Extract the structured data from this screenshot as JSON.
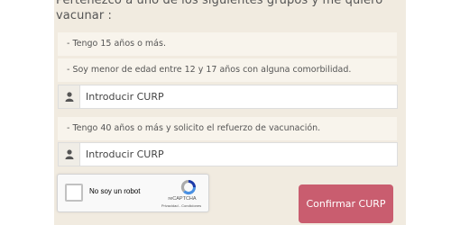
{
  "form": {
    "heading": "Pertenezco a uno de los siguientes grupos y me quiero vacunar :",
    "group1": {
      "option_a": "- Tengo 15 años o más.",
      "option_b": "- Soy menor de edad entre 12 y 17 años con alguna comorbilidad.",
      "curp_placeholder": "Introducir CURP"
    },
    "group2": {
      "option_a": "- Tengo 40 años o más y solicito el refuerzo de vacunación.",
      "curp_placeholder": "Introducir CURP"
    },
    "recaptcha": {
      "label": "No soy un robot",
      "brand": "reCAPTCHA",
      "links": "Privacidad - Condiciones"
    },
    "confirm_label": "Confirmar CURP",
    "colors": {
      "panel": "#f1ebe0",
      "confirm_button": "#c95d6f"
    },
    "icons": [
      "user-icon",
      "recaptcha-logo-icon"
    ]
  }
}
